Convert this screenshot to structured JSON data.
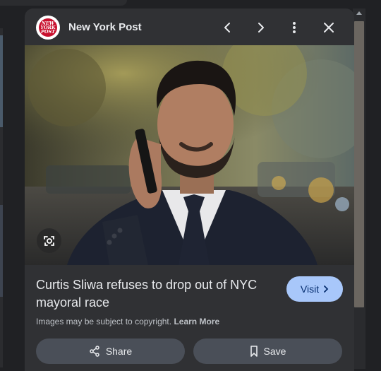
{
  "panel": {
    "source_name": "New York Post",
    "logo_text": [
      "NEW",
      "YORK",
      "POST"
    ],
    "title": "Curtis Sliwa refuses to drop out of NYC mayoral race",
    "visit_label": "Visit",
    "copyright_text": "Images may be subject to copyright.",
    "learn_more_label": "Learn More",
    "share_label": "Share",
    "save_label": "Save"
  },
  "icons": {
    "prev": "chevron-left-icon",
    "next": "chevron-right-icon",
    "more": "more-vert-icon",
    "close": "close-icon",
    "lens": "google-lens-icon",
    "visit_arrow": "chevron-right-icon",
    "share": "share-icon",
    "save": "bookmark-icon"
  },
  "colors": {
    "panel_bg": "#303134",
    "visit_bg": "#a8c7fa",
    "visit_text": "#062e6f",
    "action_bg": "#4a4f58",
    "logo_red": "#c8102e"
  }
}
